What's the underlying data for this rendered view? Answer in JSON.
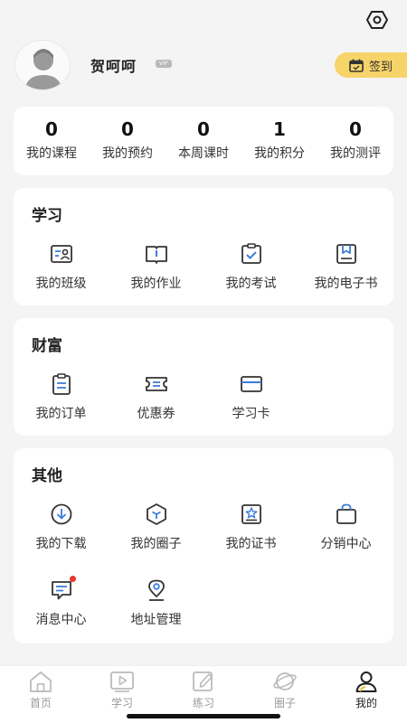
{
  "profile": {
    "username": "贺呵呵",
    "vip_label": "VIP",
    "signin_label": "签到"
  },
  "stats": [
    {
      "value": "0",
      "label": "我的课程"
    },
    {
      "value": "0",
      "label": "我的预约"
    },
    {
      "value": "0",
      "label": "本周课时"
    },
    {
      "value": "1",
      "label": "我的积分"
    },
    {
      "value": "0",
      "label": "我的测评"
    }
  ],
  "learn": {
    "title": "学习",
    "items": [
      {
        "label": "我的班级",
        "icon": "class-icon"
      },
      {
        "label": "我的作业",
        "icon": "homework-icon"
      },
      {
        "label": "我的考试",
        "icon": "exam-icon"
      },
      {
        "label": "我的电子书",
        "icon": "ebook-icon"
      }
    ]
  },
  "wealth": {
    "title": "财富",
    "items": [
      {
        "label": "我的订单",
        "icon": "order-icon"
      },
      {
        "label": "优惠券",
        "icon": "coupon-icon"
      },
      {
        "label": "学习卡",
        "icon": "study-card-icon"
      }
    ]
  },
  "other": {
    "title": "其他",
    "items": [
      {
        "label": "我的下载",
        "icon": "download-icon"
      },
      {
        "label": "我的圈子",
        "icon": "circle-icon"
      },
      {
        "label": "我的证书",
        "icon": "certificate-icon"
      },
      {
        "label": "分销中心",
        "icon": "shopping-bag-icon"
      },
      {
        "label": "消息中心",
        "icon": "message-icon"
      },
      {
        "label": "地址管理",
        "icon": "location-icon"
      }
    ]
  },
  "tabs": [
    {
      "label": "首页",
      "icon": "home-icon",
      "active": false
    },
    {
      "label": "学习",
      "icon": "video-icon",
      "active": false
    },
    {
      "label": "练习",
      "icon": "edit-icon",
      "active": false
    },
    {
      "label": "圈子",
      "icon": "planet-icon",
      "active": false
    },
    {
      "label": "我的",
      "icon": "user-icon",
      "active": true
    }
  ],
  "colors": {
    "accent_yellow": "#f7d46a",
    "icon_blue": "#3b7ddd",
    "badge_red": "#e8352f"
  }
}
